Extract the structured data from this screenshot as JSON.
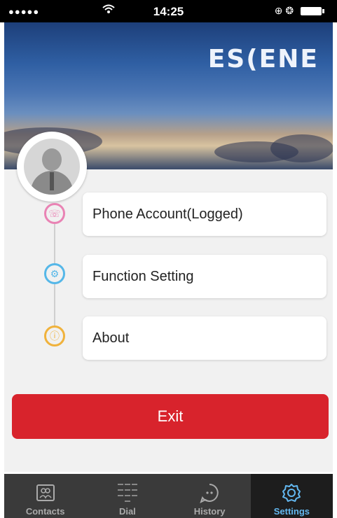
{
  "status": {
    "signal": "●●●●●",
    "time": "14:25",
    "right_icons": "⊕ ❂"
  },
  "brand": {
    "logo": "ES(ENE"
  },
  "menu": {
    "items": [
      {
        "label": "Phone Account(Logged)"
      },
      {
        "label": "Function Setting"
      },
      {
        "label": "About"
      }
    ]
  },
  "exit_label": "Exit",
  "tabs": [
    {
      "label": "Contacts",
      "icon": "contacts-icon"
    },
    {
      "label": "Dial",
      "icon": "dial-icon"
    },
    {
      "label": "History",
      "icon": "history-icon"
    },
    {
      "label": "Settings",
      "icon": "settings-icon",
      "active": true
    }
  ],
  "colors": {
    "exit": "#d8232c",
    "phone_dot": "#e983b4",
    "function_dot": "#55b7e8",
    "about_dot": "#f0b23c",
    "tab_active": "#63b8f0"
  }
}
